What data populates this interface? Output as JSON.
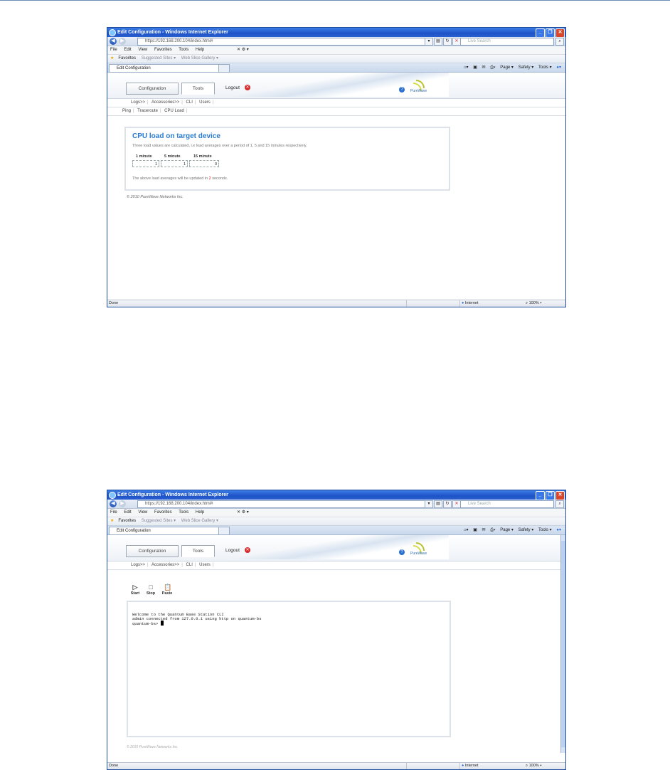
{
  "windows": [
    {
      "title": "Edit Configuration - Windows Internet Explorer",
      "address": "https://192.168.200.104/index.html#",
      "search_placeholder": "Live Search",
      "menu": [
        "File",
        "Edit",
        "View",
        "Favorites",
        "Tools",
        "Help"
      ],
      "favorites": {
        "label": "Favorites",
        "suggested": "Suggested Sites ▾",
        "gallery": "Web Slice Gallery ▾"
      },
      "tab_title": "Edit Configuration",
      "cmd": {
        "page": "Page ▾",
        "safety": "Safety ▾",
        "tools": "Tools ▾"
      },
      "app": {
        "tabs": [
          "Configuration",
          "Tools"
        ],
        "logout": "Logout",
        "logo_text": "PureWave",
        "subnav": [
          "Logs>>",
          "Accessories>>",
          "CLI",
          "Users"
        ],
        "subnav2": [
          "Ping",
          "Traceroute",
          "CPU Load"
        ],
        "panel": {
          "title": "CPU load on target device",
          "description": "Three load values are calculated, i.e load averages over a period of 1, 5 and 15 minutes respectively.",
          "headers": [
            "1 minute",
            "5 minute",
            "15 minute"
          ],
          "values": [
            "1",
            "1",
            "0"
          ],
          "update_pre": "The above load averages will be updated in ",
          "update_num": "2",
          "update_post": " seconds."
        },
        "copyright": "© 2010 PureWave Networks Inc."
      },
      "status": {
        "left": "Done",
        "zone": "Internet",
        "zoom": "100%"
      }
    },
    {
      "title": "Edit Configuration - Windows Internet Explorer",
      "address": "https://192.168.200.104/index.html#",
      "search_placeholder": "Live Search",
      "menu": [
        "File",
        "Edit",
        "View",
        "Favorites",
        "Tools",
        "Help"
      ],
      "favorites": {
        "label": "Favorites",
        "suggested": "Suggested Sites ▾",
        "gallery": "Web Slice Gallery ▾"
      },
      "tab_title": "Edit Configuration",
      "cmd": {
        "page": "Page ▾",
        "safety": "Safety ▾",
        "tools": "Tools ▾"
      },
      "app": {
        "tabs": [
          "Configuration",
          "Tools"
        ],
        "logout": "Logout",
        "logo_text": "PureWave",
        "subnav": [
          "Logs>>",
          "Accessories>>",
          "CLI",
          "Users"
        ],
        "cli_buttons": [
          "Start",
          "Stop",
          "Paste"
        ],
        "terminal": [
          "Welcome to the Quantum Base Station CLI",
          "admin connected from 127.0.0.1 using http on quantum-bs",
          "quantum-bs> "
        ],
        "copyright": "© 2010 PureWave Networks Inc."
      },
      "status": {
        "left": "Done",
        "zone": "Internet",
        "zoom": "100%"
      }
    }
  ]
}
